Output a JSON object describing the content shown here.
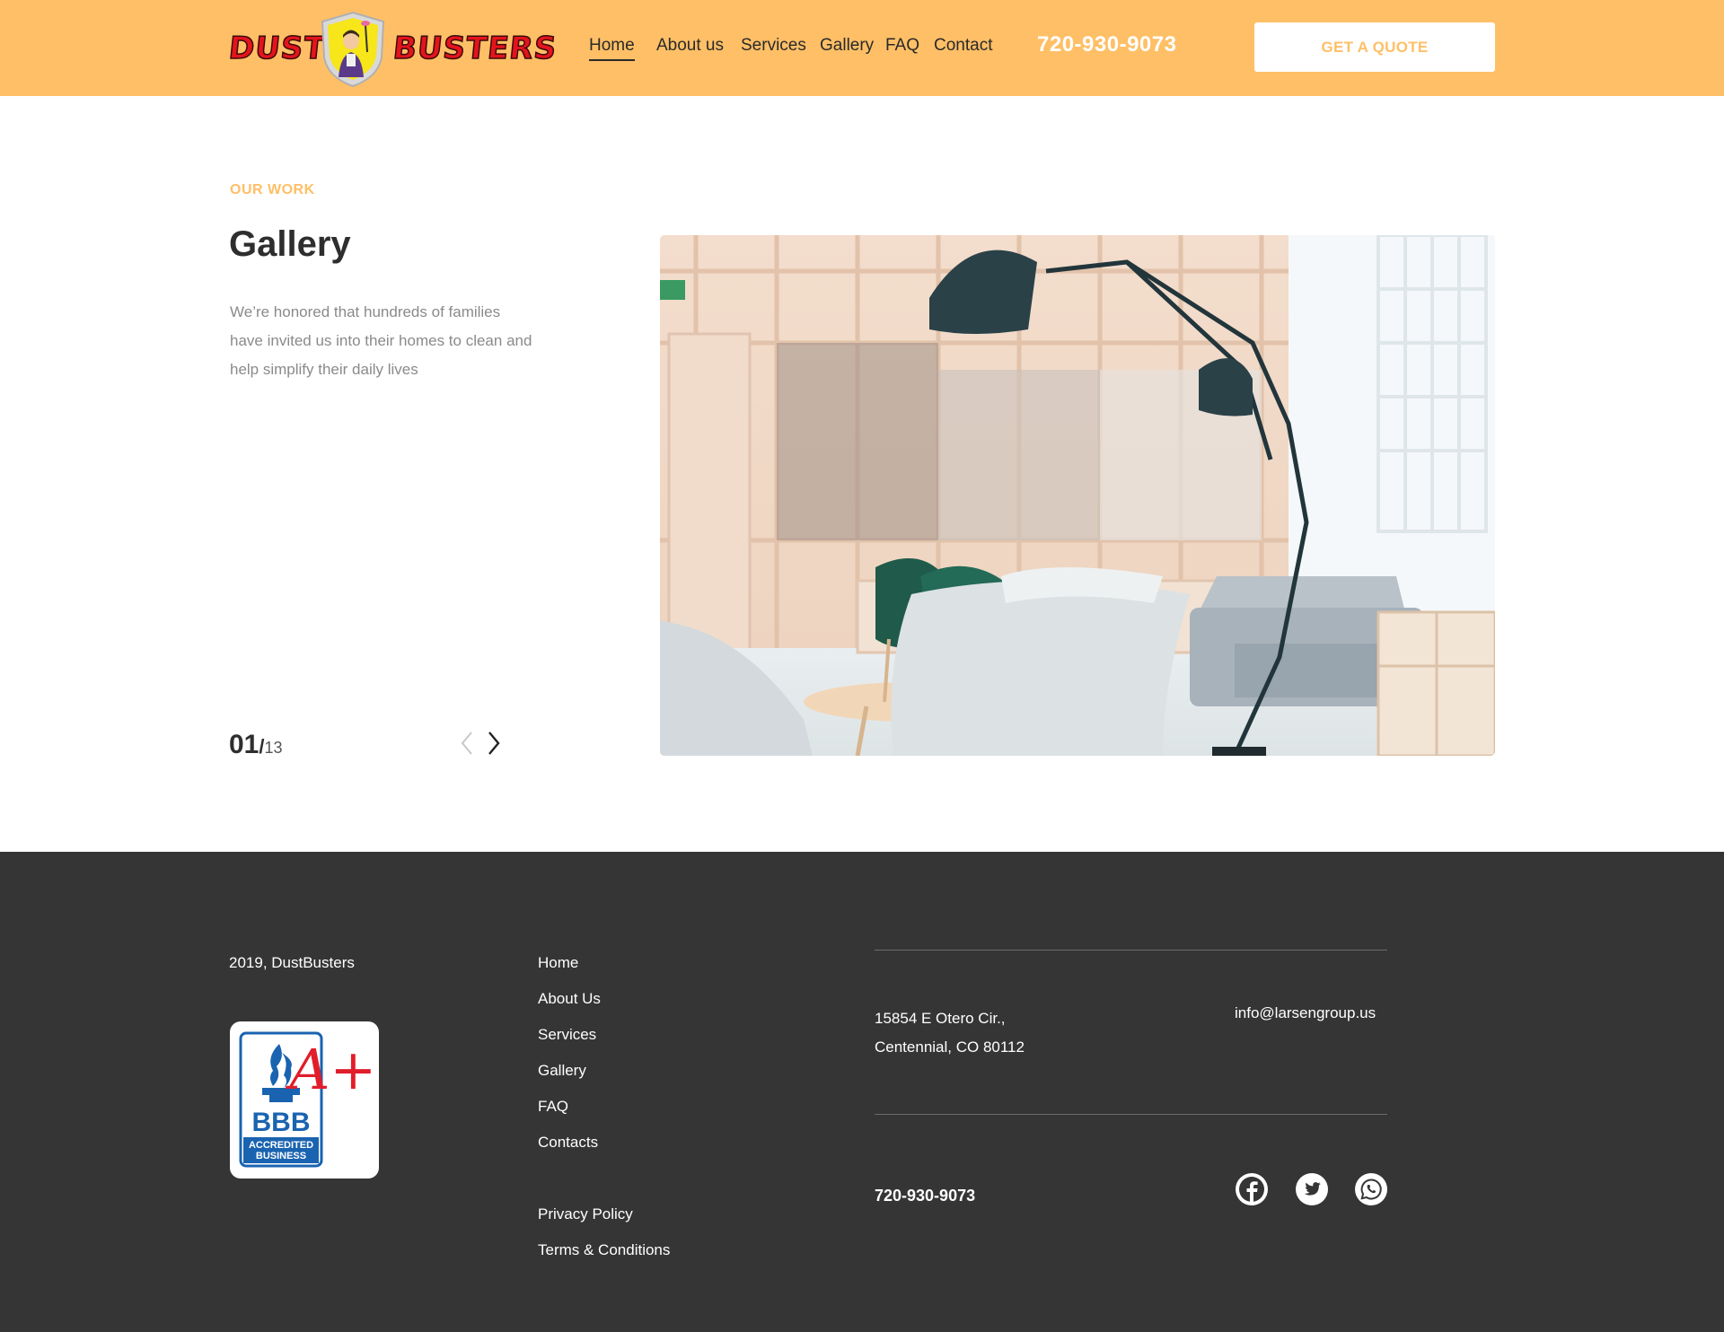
{
  "brand": {
    "logo_left": "DUST",
    "logo_right": "BUSTERS",
    "logo_colors": {
      "text": "#e3141c",
      "badge": "#f6e61a"
    }
  },
  "header": {
    "nav": [
      {
        "label": "Home",
        "active": true
      },
      {
        "label": "About us",
        "active": false
      },
      {
        "label": "Services",
        "active": false
      },
      {
        "label": "Gallery",
        "active": false
      },
      {
        "label": "FAQ",
        "active": false
      },
      {
        "label": "Contact",
        "active": false
      }
    ],
    "phone": "720-930-9073",
    "cta_label": "GET A QUOTE"
  },
  "gallery": {
    "eyebrow": "OUR WORK",
    "title": "Gallery",
    "description": "We’re honored that hundreds of families have invited us into their homes to clean and help simplify their daily lives",
    "current": "01",
    "separator": "/",
    "total": "13",
    "prev_icon": "chevron-left-icon",
    "next_icon": "chevron-right-icon",
    "image_icon": "gallery-photo"
  },
  "footer": {
    "copyright": "2019, DustBusters",
    "badge_text": {
      "bbb": "BBB",
      "rating": "A+",
      "line1": "ACCREDITED",
      "line2": "BUSINESS"
    },
    "links": [
      "Home",
      "About Us",
      "Services",
      "Gallery",
      "FAQ",
      "Contacts"
    ],
    "legal_links": [
      "Privacy Policy",
      "Terms & Conditions"
    ],
    "address_line1": "15854 E Otero Cir.,",
    "address_line2": "Centennial, CO 80112",
    "email": "info@larsengroup.us",
    "phone": "720-930-9073",
    "social": [
      "facebook-icon",
      "twitter-icon",
      "whatsapp-icon"
    ]
  },
  "colors": {
    "accent": "#ffbf66",
    "footer_bg": "#353535",
    "heading": "#2e2e2e",
    "body_text": "#8a8a8a"
  }
}
